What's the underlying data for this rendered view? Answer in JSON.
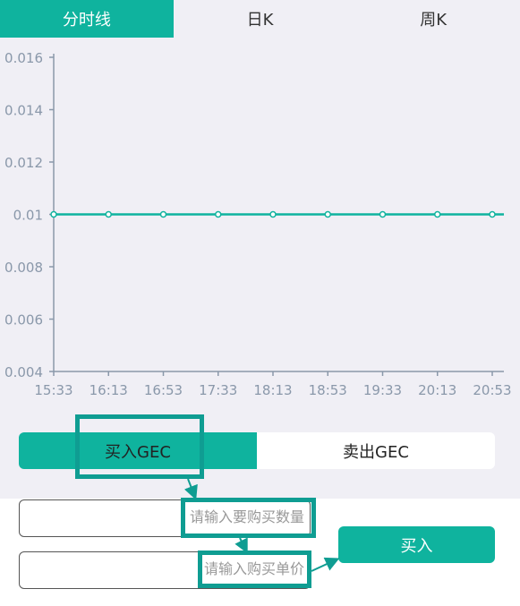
{
  "tabs": [
    {
      "label": "分时线",
      "active": true
    },
    {
      "label": "日K",
      "active": false
    },
    {
      "label": "周K",
      "active": false
    }
  ],
  "chart_data": {
    "type": "line",
    "x": [
      "15:33",
      "16:13",
      "16:53",
      "17:33",
      "18:13",
      "18:53",
      "19:33",
      "20:13",
      "20:53"
    ],
    "series": [
      {
        "values": [
          0.01,
          0.01,
          0.01,
          0.01,
          0.01,
          0.01,
          0.01,
          0.01,
          0.01
        ]
      }
    ],
    "yticks": [
      "0.016",
      "0.014",
      "0.012",
      "0.01",
      "0.008",
      "0.006",
      "0.004"
    ],
    "ylim": [
      0.004,
      0.016
    ],
    "grid": false,
    "line_color": "#0fb39e",
    "axis_color": "#8a98aa"
  },
  "trade": {
    "buy_tab": "买入GEC",
    "sell_tab": "卖出GEC",
    "quantity_placeholder": "请输入要购买数量",
    "price_placeholder": "请输入购买单价",
    "buy_button": "买入"
  },
  "colors": {
    "accent": "#0fb39e",
    "annotation": "#0f9d92"
  }
}
